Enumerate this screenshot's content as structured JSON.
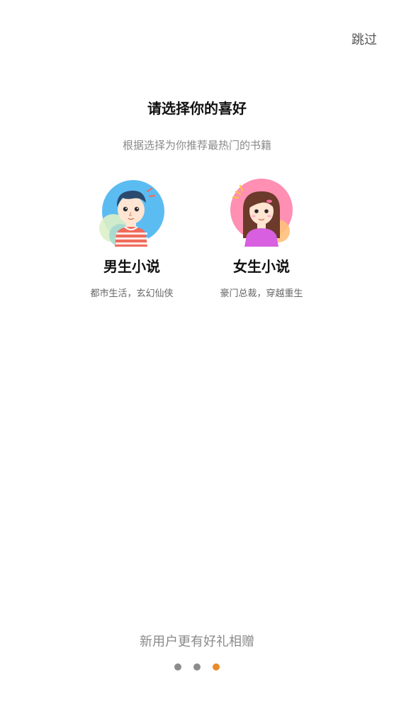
{
  "header": {
    "skip_label": "跳过"
  },
  "main": {
    "title": "请选择你的喜好",
    "subtitle": "根据选择为你推荐最热门的书籍",
    "choices": [
      {
        "label": "男生小说",
        "description": "都市生活，玄幻仙侠",
        "icon": "boy-avatar-icon",
        "circle_color": "#5bbcf2"
      },
      {
        "label": "女生小说",
        "description": "豪门总裁，穿越重生",
        "icon": "girl-avatar-icon",
        "circle_color": "#ff8fb3"
      }
    ]
  },
  "footer": {
    "promo": "新用户更有好礼相赠",
    "pagination": {
      "total": 3,
      "active_index": 2,
      "active_color": "#ea8a2a",
      "inactive_color": "#8c8c8c"
    }
  }
}
